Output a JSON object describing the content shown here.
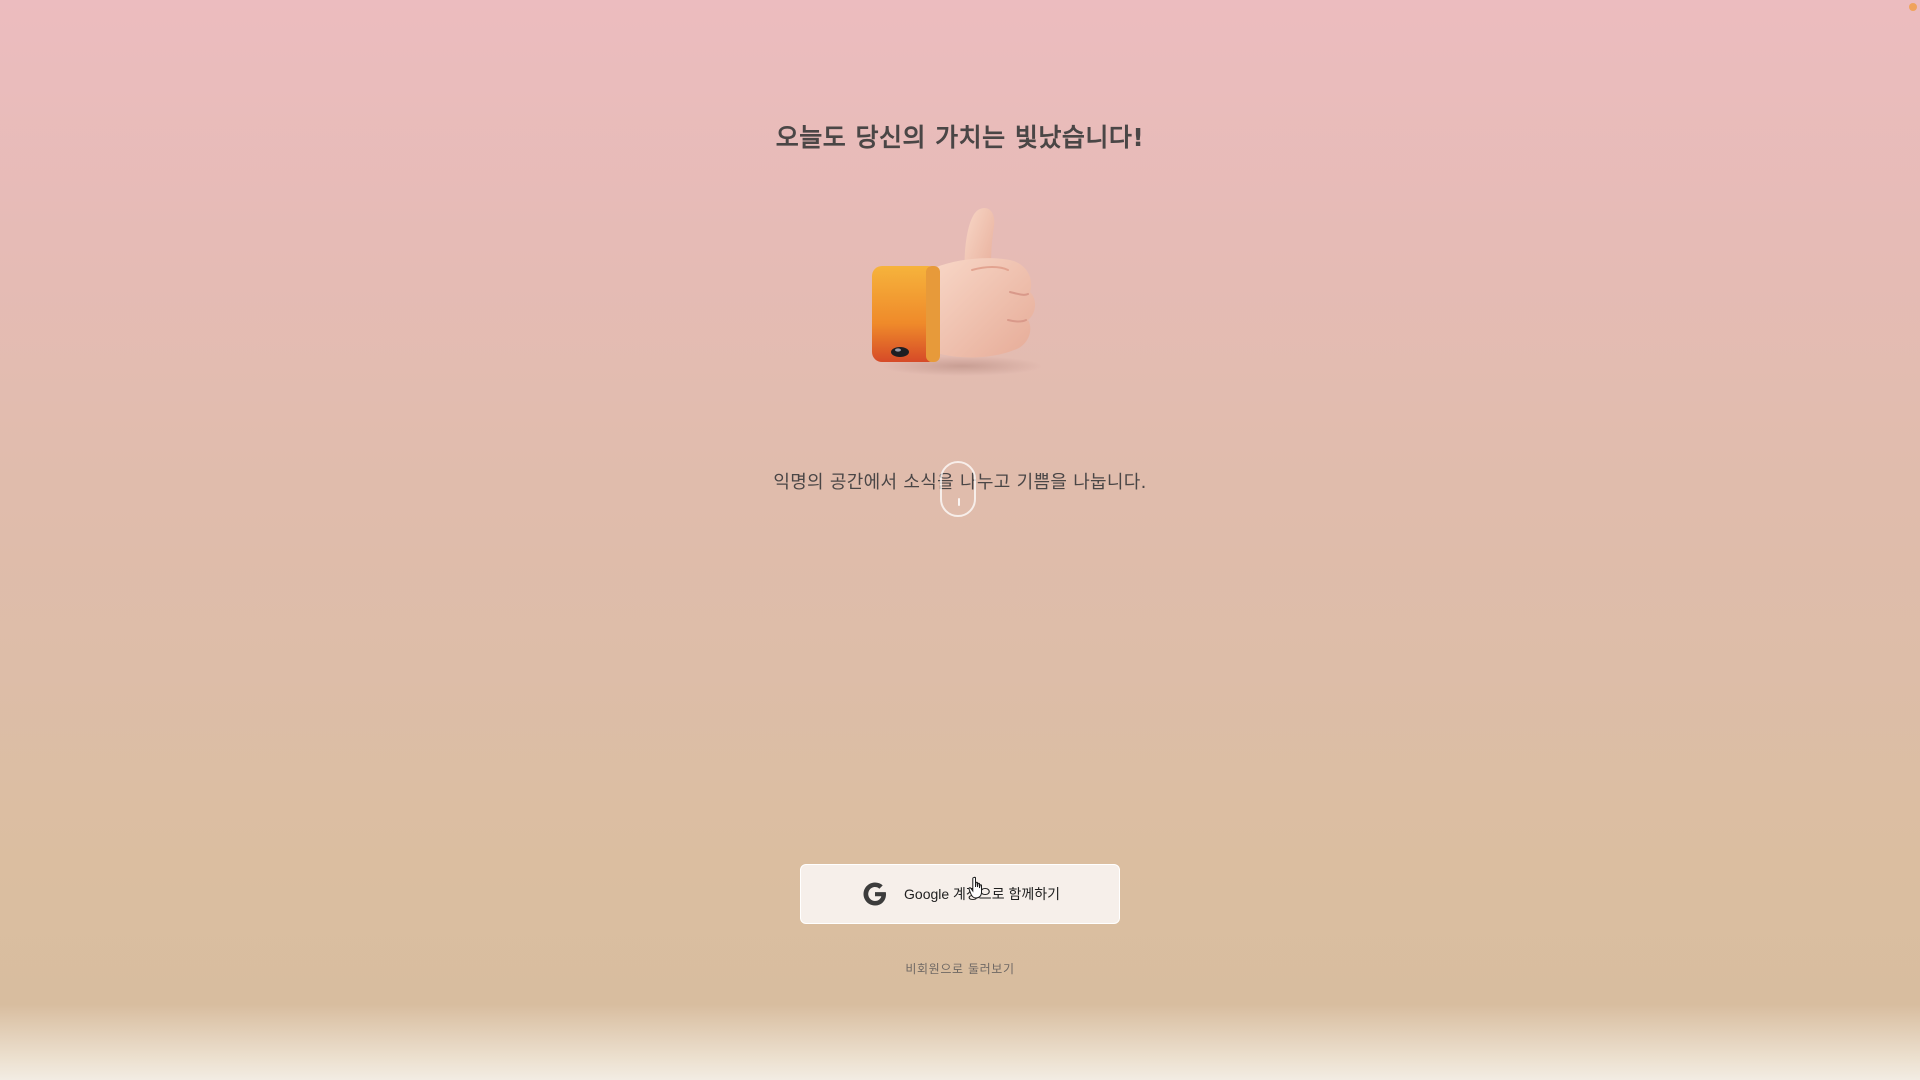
{
  "main": {
    "headline": "오늘도 당신의 가치는 빛났습니다!",
    "illustration_icon": "thumbs-up-icon",
    "subtitle": "익명의 공간에서 소식을 나누고 기쁨을 나눕니다."
  },
  "actions": {
    "google_login_label": "Google 계정으로 함께하기",
    "google_icon": "google-g-icon",
    "guest_link": "비회원으로 둘러보기"
  },
  "colors": {
    "background_top": "#ecbcbf",
    "background_bottom": "#d8bd9f",
    "button_bg": "#f6efea",
    "text": "#4a4646",
    "accent_dot": "#f0a35b"
  }
}
